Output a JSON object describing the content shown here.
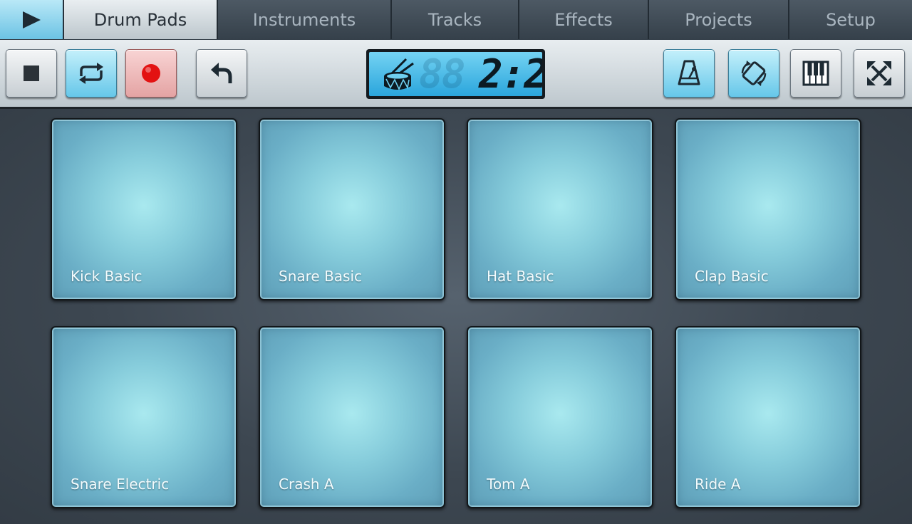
{
  "tabs": [
    {
      "label": "Drum Pads",
      "active": true
    },
    {
      "label": "Instruments",
      "active": false
    },
    {
      "label": "Tracks",
      "active": false
    },
    {
      "label": "Effects",
      "active": false
    },
    {
      "label": "Projects",
      "active": false
    },
    {
      "label": "Setup",
      "active": false
    }
  ],
  "toolbar": {
    "left_buttons": [
      {
        "icon": "stop-icon",
        "state": "off"
      },
      {
        "icon": "loop-icon",
        "state": "on"
      },
      {
        "icon": "record-icon",
        "state": "armed"
      },
      {
        "icon": "undo-icon",
        "state": "off"
      }
    ],
    "display": {
      "icon": "drum-icon",
      "ghost_digits": "88",
      "position": "2:2"
    },
    "right_buttons": [
      {
        "icon": "metronome-icon",
        "state": "on"
      },
      {
        "icon": "rotate-icon",
        "state": "on"
      },
      {
        "icon": "piano-icon",
        "state": "off"
      },
      {
        "icon": "fullscreen-icon",
        "state": "off"
      }
    ]
  },
  "pads": [
    {
      "label": "Kick Basic"
    },
    {
      "label": "Snare Basic"
    },
    {
      "label": "Hat Basic"
    },
    {
      "label": "Clap Basic"
    },
    {
      "label": "Snare Electric"
    },
    {
      "label": "Crash A"
    },
    {
      "label": "Tom A"
    },
    {
      "label": "Ride A"
    }
  ],
  "colors": {
    "accent": "#6cc3e4",
    "record": "#e31212",
    "pad": "#86ccdb",
    "background": "#3c4650"
  }
}
